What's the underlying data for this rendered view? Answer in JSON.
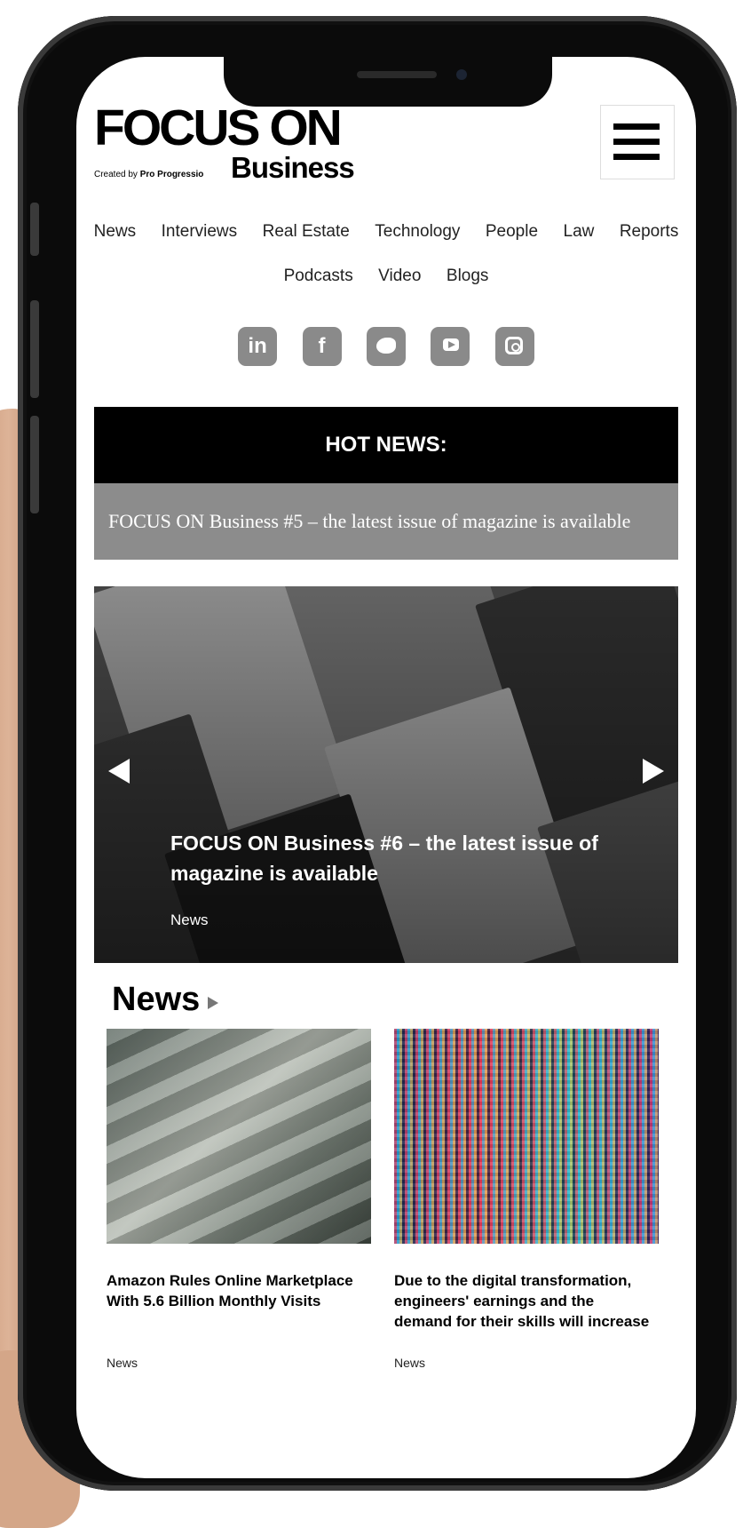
{
  "brand": {
    "logo_line1": "FOCUS ON",
    "created_by_prefix": "Created by",
    "created_by_name": "Pro Progressio",
    "logo_line2": "Business"
  },
  "nav": {
    "row1": [
      "News",
      "Interviews",
      "Real Estate",
      "Technology",
      "People",
      "Law",
      "Reports"
    ],
    "row2": [
      "Podcasts",
      "Video",
      "Blogs"
    ]
  },
  "socials": [
    "linkedin-icon",
    "facebook-icon",
    "twitter-icon",
    "youtube-icon",
    "instagram-icon"
  ],
  "hot_news": {
    "label": "HOT NEWS:",
    "ticker": "FOCUS ON Business #5 – the latest issue of  magazine is available"
  },
  "slider": {
    "title": "FOCUS ON Business #6 – the latest issue of  magazine is available",
    "category": "News"
  },
  "news_section": {
    "heading": "News",
    "cards": [
      {
        "title": "Amazon Rules Online Marketplace With 5.6 Billion Monthly Visits",
        "category": "News"
      },
      {
        "title": "Due to the digital transformation, engineers' earnings and the demand for their skills will increase",
        "category": "News"
      }
    ]
  },
  "colors": {
    "hot_news_bg": "#000000",
    "ticker_bg": "#8c8c8c",
    "social_icon_bg": "#8a8a8a"
  }
}
